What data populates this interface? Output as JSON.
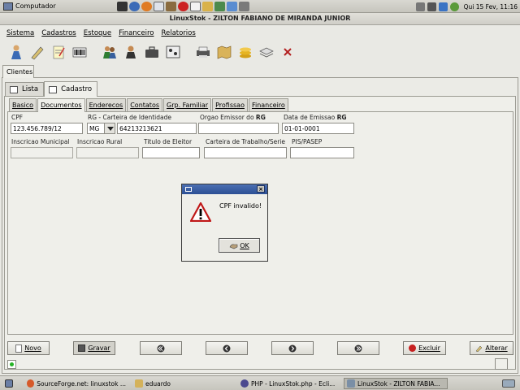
{
  "top_panel": {
    "computer_label": "Computador",
    "clock": "Qui 15 Fev, 11:16"
  },
  "window": {
    "title": "LinuxStok - ZILTON FABIANO DE MIRANDA JUNIOR"
  },
  "menu": [
    "Sistema",
    "Cadastros",
    "Estoque",
    "Financeiro",
    "Relatorios"
  ],
  "toolbar_icons": [
    "person-icon",
    "pen-icon",
    "notepad-icon",
    "barcode-icon",
    "people-icon",
    "user-icon",
    "briefcase-icon",
    "scanner-icon",
    "printer-icon",
    "map-icon",
    "coins-icon",
    "stack-icon",
    "close-icon"
  ],
  "module_tab": "Clientes",
  "view_tabs": [
    "Lista",
    "Cadastro"
  ],
  "detail_tabs": [
    "Basico",
    "Documentos",
    "Enderecos",
    "Contatos",
    "Grp. Familiar",
    "Profissao",
    "Financeiro"
  ],
  "form": {
    "cpf_label": "CPF",
    "cpf_value": "123.456.789/12",
    "rg_label": "RG - Carteira de Identidade",
    "rg_uf": "MG",
    "rg_number": "64213213621",
    "orgao_label_prefix": "Orgao Emissor do ",
    "orgao_label_bold": "RG",
    "data_label_prefix": "Data de Emissao ",
    "data_label_bold": "RG",
    "data_value": "01-01-0001",
    "im_label": "Inscricao Municipal",
    "ir_label": "Inscricao Rural",
    "titulo_label": "Titulo de Eleitor",
    "carteira_label": "Carteira de Trabalho/Serie",
    "pis_label": "PIS/PASEP"
  },
  "dialog": {
    "message": "CPF invalido!",
    "ok_label": "OK"
  },
  "buttons": {
    "novo": "Novo",
    "gravar": "Gravar",
    "excluir": "Excluir",
    "alterar": "Alterar"
  },
  "taskbar": [
    "SourceForge.net: linuxstok ...",
    "eduardo",
    "PHP - LinuxStok.php - Ecli...",
    "LinuxStok - ZILTON FABIA..."
  ]
}
